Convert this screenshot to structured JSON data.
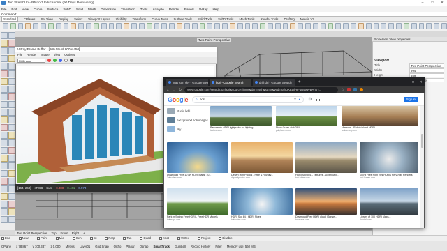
{
  "window": {
    "title": "Ten SketchUp - Rhino 7 Educational (90 Days Remaining)"
  },
  "menu": [
    "File",
    "Edit",
    "View",
    "Curve",
    "Surface",
    "SubD",
    "Solid",
    "Mesh",
    "Dimension",
    "Transform",
    "Tools",
    "Analyze",
    "Render",
    "Panels",
    "V-Ray",
    "Help"
  ],
  "command": {
    "label": "Command:"
  },
  "tool_tabs": [
    "Standard",
    "CPlanes",
    "Set View",
    "Display",
    "Select",
    "Viewport Layout",
    "Visibility",
    "Transform",
    "Curve Tools",
    "Surface Tools",
    "Solid Tools",
    "SubD Tools",
    "Mesh Tools",
    "Render Tools",
    "Drafting",
    "New in V7"
  ],
  "viewport": {
    "label": "Two Point Perspective"
  },
  "view_tabs": [
    "Two Point Perspective",
    "Top",
    "Front",
    "Right",
    "+"
  ],
  "osnap": [
    "End",
    "Near",
    "Point",
    "Mid",
    "Cen",
    "Int",
    "Perp",
    "Tan",
    "Quad",
    "Knot",
    "Vertex",
    "Project",
    "Disable"
  ],
  "status": {
    "cplane": "CPlane",
    "x": "x 78.867",
    "y": "y 100.337",
    "z": "z 0.000",
    "units": "Meters",
    "layer": "Layer01",
    "items": [
      "Grid Snap",
      "Ortho",
      "Planar",
      "Osnap",
      "SmartTrack",
      "Gumball",
      "Record History",
      "Filter",
      "Memory use: 560 MB"
    ],
    "active": "SmartTrack"
  },
  "properties": {
    "header": "Properties: View properties",
    "section": "Viewport",
    "rows": [
      {
        "k": "Title",
        "v": "Two Point Perspective"
      },
      {
        "k": "Width",
        "v": "994"
      },
      {
        "k": "Height",
        "v": "559"
      },
      {
        "k": "Projection",
        "v": "Perspective"
      }
    ]
  },
  "vfb": {
    "title": "V-Ray Frame Buffer - [100.0% of 800 x 450]",
    "menu": [
      "File",
      "Render",
      "Image",
      "View",
      "Options"
    ],
    "channel": "RGB color",
    "coords": "[164, 260]",
    "mode": "sRGB",
    "zoom_label": "Sum",
    "r": "0.388",
    "g": "0.461",
    "b": "0.573"
  },
  "chrome": {
    "tabs": [
      {
        "label": "vray sun sky - Google Search",
        "active": false
      },
      {
        "label": "hdri - Google Search",
        "active": true
      },
      {
        "label": "dri hdri - Google Search",
        "active": false
      }
    ],
    "url": "www.google.com/search?q=hdri&source=lnms&tbm=isch&sa=X&ved=2ahUKEwjH8-ug4MWBAhVT...",
    "query": "hdri",
    "signin": "Sign in",
    "suggestions": [
      "studio hdri",
      "background hdri images",
      "sky"
    ],
    "results": [
      {
        "cap": "Panoramic HDRI lightprobe for lighting...",
        "src": "texture.com"
      },
      {
        "cap": "Noon Grass 4k HDRI",
        "src": "polyhaven.com"
      },
      {
        "cap": "Marzone - Ralfoh island HDRI",
        "src": "ambientcg.com"
      },
      {
        "cap": "Download Free 10 8K HDRI Maps: 10...",
        "src": "3dmodels.com"
      },
      {
        "cap": "Desert Hdri Photos - Free & Royalty...",
        "src": "depositphotos.com"
      },
      {
        "cap": "HDRI Sky 501 - Textures - Download...",
        "src": "hdri-skies.com"
      },
      {
        "cap": "100% Free High Res HDRIs for V-Ray Renders",
        "src": "hdri-haven.com"
      },
      {
        "cap": "Park in Spring Free HDRI - Free HDR Models",
        "src": "hdrmaps.com"
      },
      {
        "cap": "HDRI Sky 84 - HDRI Skies",
        "src": "hdri-skies.com"
      },
      {
        "cap": "Download Free HDRI cloud (Sunset...",
        "src": "hdrmaps.com"
      },
      {
        "cap": "Library of 100 HDRI Maps...",
        "src": "3dtotal.com"
      }
    ]
  },
  "colors": {
    "google_blue": "#4285f4",
    "chrome_dark": "#202124",
    "signin": "#1a73e8"
  }
}
